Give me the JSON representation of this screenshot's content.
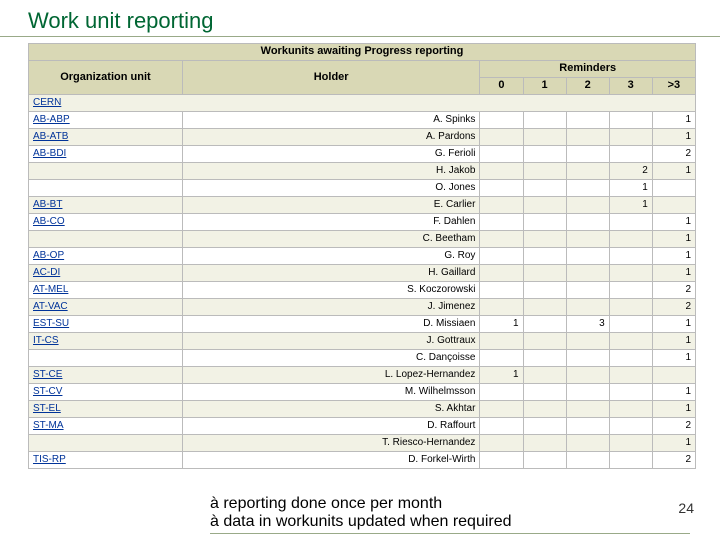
{
  "title": "Work unit reporting",
  "table_header": "Workunits awaiting Progress reporting",
  "col_org": "Organization unit",
  "col_holder": "Holder",
  "col_reminders": "Reminders",
  "rem_cols": [
    "0",
    "1",
    "2",
    "3",
    ">3"
  ],
  "cern_label": "CERN",
  "rows": [
    {
      "org": "AB-ABP",
      "holder": "A. Spinks",
      "r": [
        "",
        "",
        "",
        "",
        "1"
      ]
    },
    {
      "org": "AB-ATB",
      "holder": "A. Pardons",
      "r": [
        "",
        "",
        "",
        "",
        "1"
      ]
    },
    {
      "org": "AB-BDI",
      "holder": "G. Ferioli",
      "r": [
        "",
        "",
        "",
        "",
        "2"
      ]
    },
    {
      "org": "",
      "holder": "H. Jakob",
      "r": [
        "",
        "",
        "",
        "2",
        "1"
      ]
    },
    {
      "org": "",
      "holder": "O. Jones",
      "r": [
        "",
        "",
        "",
        "1",
        ""
      ]
    },
    {
      "org": "AB-BT",
      "holder": "E. Carlier",
      "r": [
        "",
        "",
        "",
        "1",
        ""
      ]
    },
    {
      "org": "AB-CO",
      "holder": "F. Dahlen",
      "r": [
        "",
        "",
        "",
        "",
        "1"
      ]
    },
    {
      "org": "",
      "holder": "C. Beetham",
      "r": [
        "",
        "",
        "",
        "",
        "1"
      ]
    },
    {
      "org": "AB-OP",
      "holder": "G. Roy",
      "r": [
        "",
        "",
        "",
        "",
        "1"
      ]
    },
    {
      "org": "AC-DI",
      "holder": "H. Gaillard",
      "r": [
        "",
        "",
        "",
        "",
        "1"
      ]
    },
    {
      "org": "AT-MEL",
      "holder": "S. Koczorowski",
      "r": [
        "",
        "",
        "",
        "",
        "2"
      ]
    },
    {
      "org": "AT-VAC",
      "holder": "J. Jimenez",
      "r": [
        "",
        "",
        "",
        "",
        "2"
      ]
    },
    {
      "org": "EST-SU",
      "holder": "D. Missiaen",
      "r": [
        "1",
        "",
        "3",
        "",
        "1"
      ]
    },
    {
      "org": "IT-CS",
      "holder": "J. Gottraux",
      "r": [
        "",
        "",
        "",
        "",
        "1"
      ]
    },
    {
      "org": "",
      "holder": "C. Dançoisse",
      "r": [
        "",
        "",
        "",
        "",
        "1"
      ]
    },
    {
      "org": "ST-CE",
      "holder": "L. Lopez-Hernandez",
      "r": [
        "1",
        "",
        "",
        "",
        ""
      ]
    },
    {
      "org": "ST-CV",
      "holder": "M. Wilhelmsson",
      "r": [
        "",
        "",
        "",
        "",
        "1"
      ]
    },
    {
      "org": "ST-EL",
      "holder": "S. Akhtar",
      "r": [
        "",
        "",
        "",
        "",
        "1"
      ]
    },
    {
      "org": "ST-MA",
      "holder": "D. Raffourt",
      "r": [
        "",
        "",
        "",
        "",
        "2"
      ]
    },
    {
      "org": "",
      "holder": "T. Riesco-Hernandez",
      "r": [
        "",
        "",
        "",
        "",
        "1"
      ]
    },
    {
      "org": "TIS-RP",
      "holder": "D. Forkel-Wirth",
      "r": [
        "",
        "",
        "",
        "",
        "2"
      ]
    }
  ],
  "footer_line1": "à reporting done once per month",
  "footer_line2": "à data in workunits updated when required",
  "page_number": "24",
  "chart_data": {
    "type": "table",
    "title": "Workunits awaiting Progress reporting",
    "columns": [
      "Organization unit",
      "Holder",
      "Reminders 0",
      "Reminders 1",
      "Reminders 2",
      "Reminders 3",
      "Reminders >3"
    ],
    "rows": [
      [
        "AB-ABP",
        "A. Spinks",
        null,
        null,
        null,
        null,
        1
      ],
      [
        "AB-ATB",
        "A. Pardons",
        null,
        null,
        null,
        null,
        1
      ],
      [
        "AB-BDI",
        "G. Ferioli",
        null,
        null,
        null,
        null,
        2
      ],
      [
        "",
        "H. Jakob",
        null,
        null,
        null,
        2,
        1
      ],
      [
        "",
        "O. Jones",
        null,
        null,
        null,
        1,
        null
      ],
      [
        "AB-BT",
        "E. Carlier",
        null,
        null,
        null,
        1,
        null
      ],
      [
        "AB-CO",
        "F. Dahlen",
        null,
        null,
        null,
        null,
        1
      ],
      [
        "",
        "C. Beetham",
        null,
        null,
        null,
        null,
        1
      ],
      [
        "AB-OP",
        "G. Roy",
        null,
        null,
        null,
        null,
        1
      ],
      [
        "AC-DI",
        "H. Gaillard",
        null,
        null,
        null,
        null,
        1
      ],
      [
        "AT-MEL",
        "S. Koczorowski",
        null,
        null,
        null,
        null,
        2
      ],
      [
        "AT-VAC",
        "J. Jimenez",
        null,
        null,
        null,
        null,
        2
      ],
      [
        "EST-SU",
        "D. Missiaen",
        1,
        null,
        3,
        null,
        1
      ],
      [
        "IT-CS",
        "J. Gottraux",
        null,
        null,
        null,
        null,
        1
      ],
      [
        "",
        "C. Dançoisse",
        null,
        null,
        null,
        null,
        1
      ],
      [
        "ST-CE",
        "L. Lopez-Hernandez",
        1,
        null,
        null,
        null,
        null
      ],
      [
        "ST-CV",
        "M. Wilhelmsson",
        null,
        null,
        null,
        null,
        1
      ],
      [
        "ST-EL",
        "S. Akhtar",
        null,
        null,
        null,
        null,
        1
      ],
      [
        "ST-MA",
        "D. Raffourt",
        null,
        null,
        null,
        null,
        2
      ],
      [
        "",
        "T. Riesco-Hernandez",
        null,
        null,
        null,
        null,
        1
      ],
      [
        "TIS-RP",
        "D. Forkel-Wirth",
        null,
        null,
        null,
        null,
        2
      ]
    ]
  }
}
